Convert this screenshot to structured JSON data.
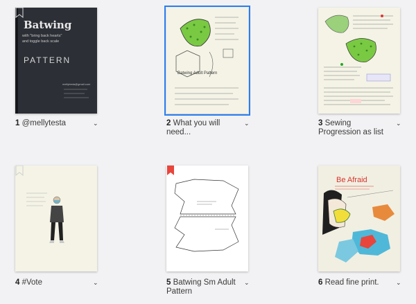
{
  "pages": [
    {
      "number": "1",
      "label": "@mellytesta",
      "cover_title": "Batwing",
      "cover_line1": "with \"bring back hearts\"",
      "cover_line2": "and toggle back scale",
      "cover_word": "PATTERN",
      "cover_credit": "mellytesta@gmail.com"
    },
    {
      "number": "2",
      "label": "What you will need...",
      "heading": "Batwing Adult Pattern"
    },
    {
      "number": "3",
      "label": "Sewing Progression as list"
    },
    {
      "number": "4",
      "label": "#Vote"
    },
    {
      "number": "5",
      "label": "Batwing Sm Adult Pattern"
    },
    {
      "number": "6",
      "label": "Read fine print.",
      "title": "Be Afraid"
    }
  ],
  "icons": {
    "menu": "chevron-down-icon",
    "bookmark": "bookmark-icon"
  },
  "colors": {
    "selection": "#2a7ef0",
    "bookmark_red": "#e8453c",
    "cover_dark": "#2c2f36",
    "paper": "#f4f3e6"
  }
}
